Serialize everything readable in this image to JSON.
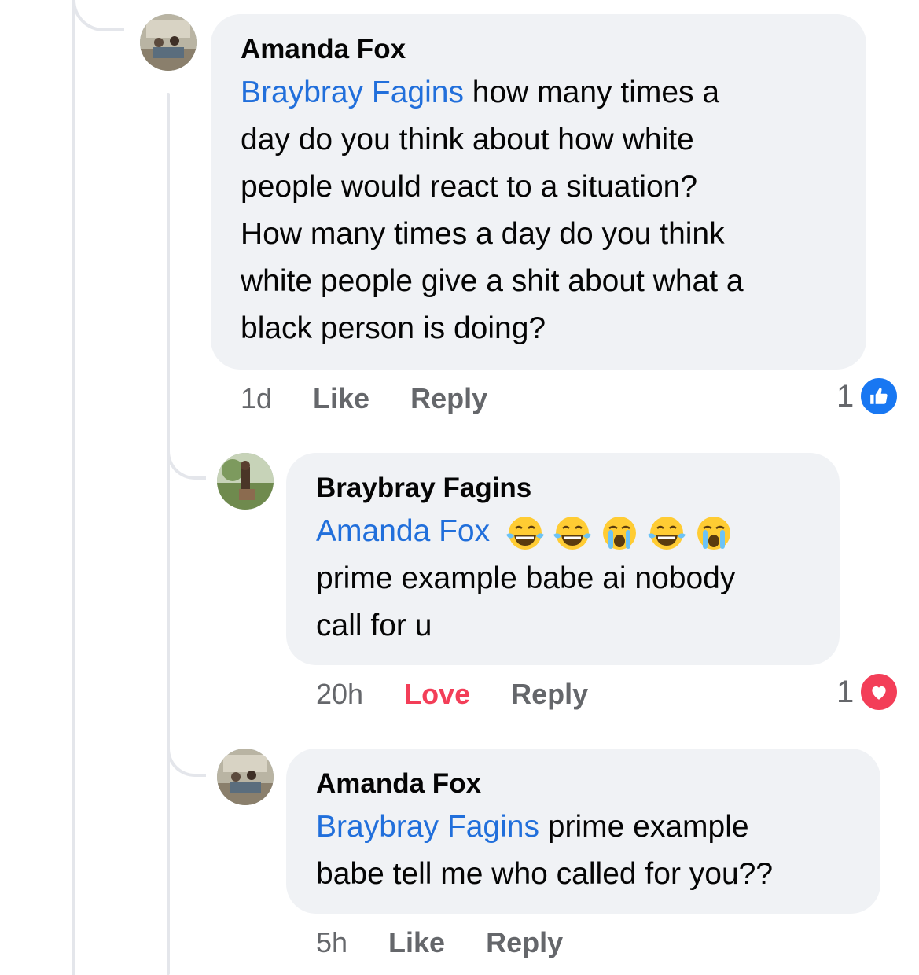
{
  "comments": [
    {
      "author": "Amanda Fox",
      "mention": "Braybray Fagins",
      "text_line1": " how many times a",
      "text_lines": [
        "day do you think about how white",
        "people would react to a situation?",
        "How many times a day do you think",
        "white people give a shit about what a",
        "black person is doing?"
      ],
      "time": "1d",
      "like_label": "Like",
      "reply_label": "Reply",
      "reaction_count": "1",
      "reaction_icon": "like-icon"
    },
    {
      "author": "Braybray Fagins",
      "mention": "Amanda Fox",
      "emojis": [
        "laughing-tears-emoji",
        "laughing-tears-emoji",
        "crying-emoji",
        "laughing-tears-emoji",
        "crying-emoji"
      ],
      "text_lines": [
        "prime example babe ai nobody",
        "call for u"
      ],
      "time": "20h",
      "like_label": "Love",
      "reply_label": "Reply",
      "reaction_count": "1",
      "reaction_icon": "love-icon"
    },
    {
      "author": "Amanda Fox",
      "mention": "Braybray Fagins",
      "text_line1": " prime example",
      "text_lines": [
        "babe tell me who called for you??"
      ],
      "time": "5h",
      "like_label": "Like",
      "reply_label": "Reply"
    }
  ],
  "colors": {
    "mention": "#216fdb",
    "love": "#f33e58",
    "like": "#1877f2",
    "bubble": "#f0f2f5",
    "meta": "#65676b"
  }
}
